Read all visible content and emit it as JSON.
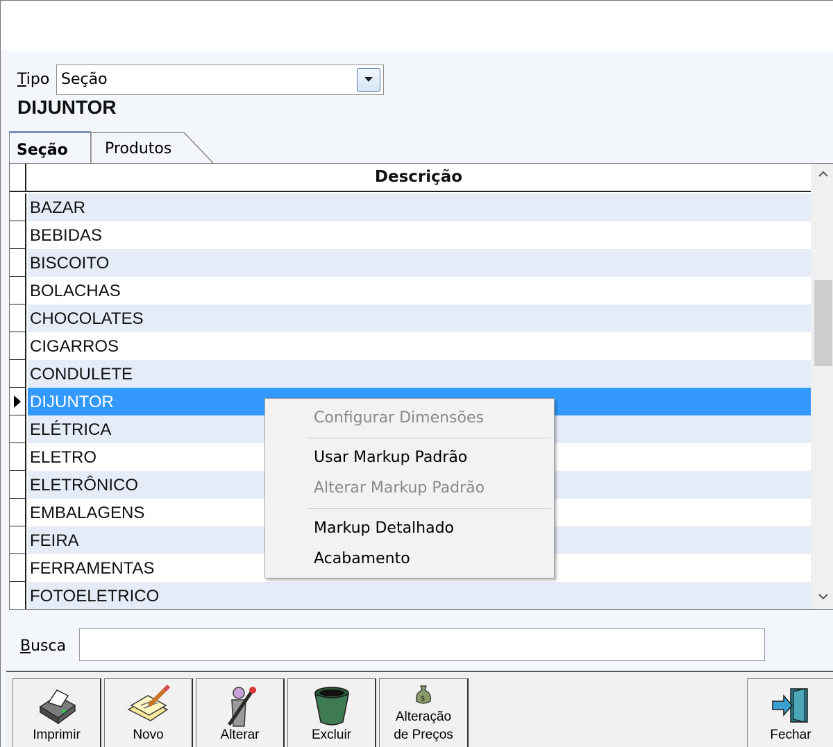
{
  "form": {
    "tipo_label_underlined": "T",
    "tipo_label_rest": "ipo",
    "tipo_value": "Seção",
    "heading": "DIJUNTOR"
  },
  "tabs": [
    {
      "label": "Seção",
      "active": true
    },
    {
      "label": "Produtos",
      "active": false
    }
  ],
  "grid": {
    "column_header": "Descrição",
    "selected_row": "DIJUNTOR",
    "rows": [
      "BAZAR",
      "BEBIDAS",
      "BISCOITO",
      "BOLACHAS",
      "CHOCOLATES",
      "CIGARROS",
      "CONDULETE",
      "DIJUNTOR",
      "ELÉTRICA",
      "ELETRO",
      "ELETRÔNICO",
      "EMBALAGENS",
      "FEIRA",
      "FERRAMENTAS",
      "FOTOELETRICO"
    ]
  },
  "search": {
    "label_underlined": "B",
    "label_rest": "usca",
    "value": ""
  },
  "context_menu": {
    "items": [
      {
        "label": "Configurar Dimensões",
        "enabled": false
      },
      {
        "label": "Usar Markup Padrão",
        "enabled": true
      },
      {
        "label": "Alterar Markup Padrão",
        "enabled": false
      },
      {
        "label": "Markup Detalhado",
        "enabled": true
      },
      {
        "label": "Acabamento",
        "enabled": true
      }
    ]
  },
  "toolbar": {
    "imprimir": "Imprimir",
    "novo": "Novo",
    "alterar": "Alterar",
    "excluir": "Excluir",
    "alteracao_line1": "Alteração",
    "alteracao_line2": "de Preços",
    "fechar": "Fechar"
  },
  "colors": {
    "selection": "#3399ff",
    "alt_row": "#e5ecf8",
    "window_bg": "#f3f6fb"
  }
}
